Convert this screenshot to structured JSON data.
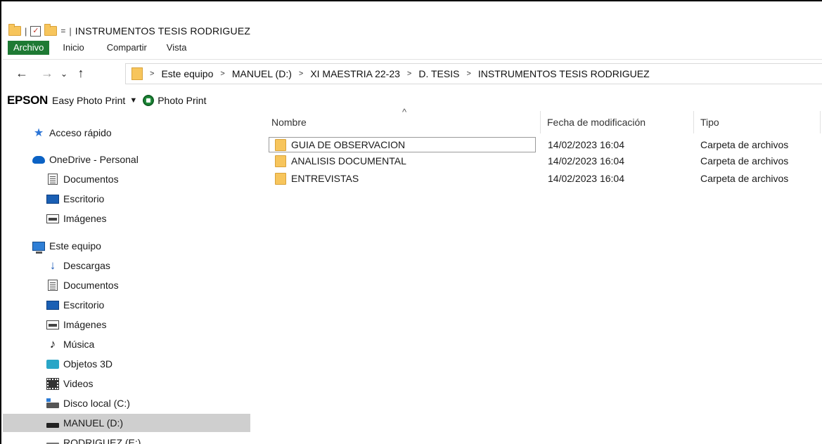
{
  "window": {
    "title": "INSTRUMENTOS TESIS RODRIGUEZ",
    "qat_separator": "|",
    "qat_check": "✓",
    "qat_dropdown": "="
  },
  "ribbon": {
    "tabs": [
      "Archivo",
      "Inicio",
      "Compartir",
      "Vista"
    ]
  },
  "nav_buttons": {
    "back": "←",
    "forward": "→",
    "recent": "⌄",
    "up": "↑"
  },
  "address": {
    "separator": ">",
    "crumbs": [
      "Este equipo",
      "MANUEL (D:)",
      "XI MAESTRIA 22-23",
      "D. TESIS",
      "INSTRUMENTOS TESIS RODRIGUEZ"
    ]
  },
  "toolbar": {
    "brand": "EPSON",
    "easy_photo_print": "Easy Photo Print",
    "dropdown_arrow": "▼",
    "photo_print": "Photo Print"
  },
  "sidebar": {
    "items": [
      {
        "label": "Acceso rápido",
        "icon": "star-icon"
      },
      {
        "label": "OneDrive - Personal",
        "icon": "cloud-icon"
      },
      {
        "label": "Documentos",
        "icon": "documents-icon"
      },
      {
        "label": "Escritorio",
        "icon": "desktop-icon"
      },
      {
        "label": "Imágenes",
        "icon": "pictures-icon"
      },
      {
        "label": "Este equipo",
        "icon": "computer-icon"
      },
      {
        "label": "Descargas",
        "icon": "download-icon"
      },
      {
        "label": "Documentos",
        "icon": "documents-icon"
      },
      {
        "label": "Escritorio",
        "icon": "desktop-icon"
      },
      {
        "label": "Imágenes",
        "icon": "pictures-icon"
      },
      {
        "label": "Música",
        "icon": "music-icon"
      },
      {
        "label": "Objetos 3D",
        "icon": "3d-objects-icon"
      },
      {
        "label": "Videos",
        "icon": "videos-icon"
      },
      {
        "label": "Disco local (C:)",
        "icon": "local-disk-icon"
      },
      {
        "label": "MANUEL (D:)",
        "icon": "usb-drive-icon",
        "selected": true
      },
      {
        "label": "RODRIGUEZ (E:)",
        "icon": "removable-drive-icon"
      }
    ]
  },
  "file_list": {
    "columns": [
      "Nombre",
      "Fecha de modificación",
      "Tipo"
    ],
    "sort_indicator": "^",
    "rows": [
      {
        "name": "GUIA DE OBSERVACION",
        "modified": "14/02/2023 16:04",
        "type": "Carpeta de archivos"
      },
      {
        "name": "ANALISIS DOCUMENTAL",
        "modified": "14/02/2023 16:04",
        "type": "Carpeta de archivos"
      },
      {
        "name": "ENTREVISTAS",
        "modified": "14/02/2023 16:04",
        "type": "Carpeta de archivos"
      }
    ]
  },
  "colors": {
    "archivo_tab": "#1e7a34",
    "folder": "#f7c55c",
    "selection": "#cfcfcf"
  }
}
